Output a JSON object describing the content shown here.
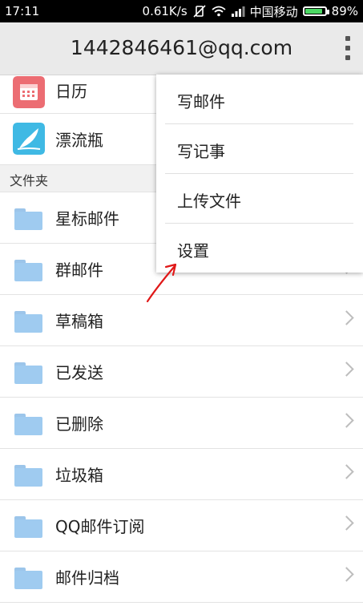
{
  "status_bar": {
    "time": "17:11",
    "speed": "0.61K/s",
    "carrier": "中国移动",
    "battery_percent": "89%",
    "battery_level": 0.89
  },
  "header": {
    "title": "1442846461@qq.com"
  },
  "apps": [
    {
      "label": "日历",
      "icon": "calendar-icon",
      "color": "#ec6d73"
    },
    {
      "label": "漂流瓶",
      "icon": "drift-bottle-icon",
      "color": "#3fb9e4"
    }
  ],
  "folders_section": {
    "label": "文件夹"
  },
  "folders": [
    {
      "label": "星标邮件"
    },
    {
      "label": "群邮件"
    },
    {
      "label": "草稿箱"
    },
    {
      "label": "已发送"
    },
    {
      "label": "已删除"
    },
    {
      "label": "垃圾箱"
    },
    {
      "label": "QQ邮件订阅"
    },
    {
      "label": "邮件归档"
    }
  ],
  "menu": {
    "items": [
      {
        "label": "写邮件"
      },
      {
        "label": "写记事"
      },
      {
        "label": "上传文件"
      },
      {
        "label": "设置"
      }
    ]
  },
  "colors": {
    "folder": "#9fcbf0",
    "annotation_arrow": "#e01818",
    "battery": "#4cd964"
  }
}
